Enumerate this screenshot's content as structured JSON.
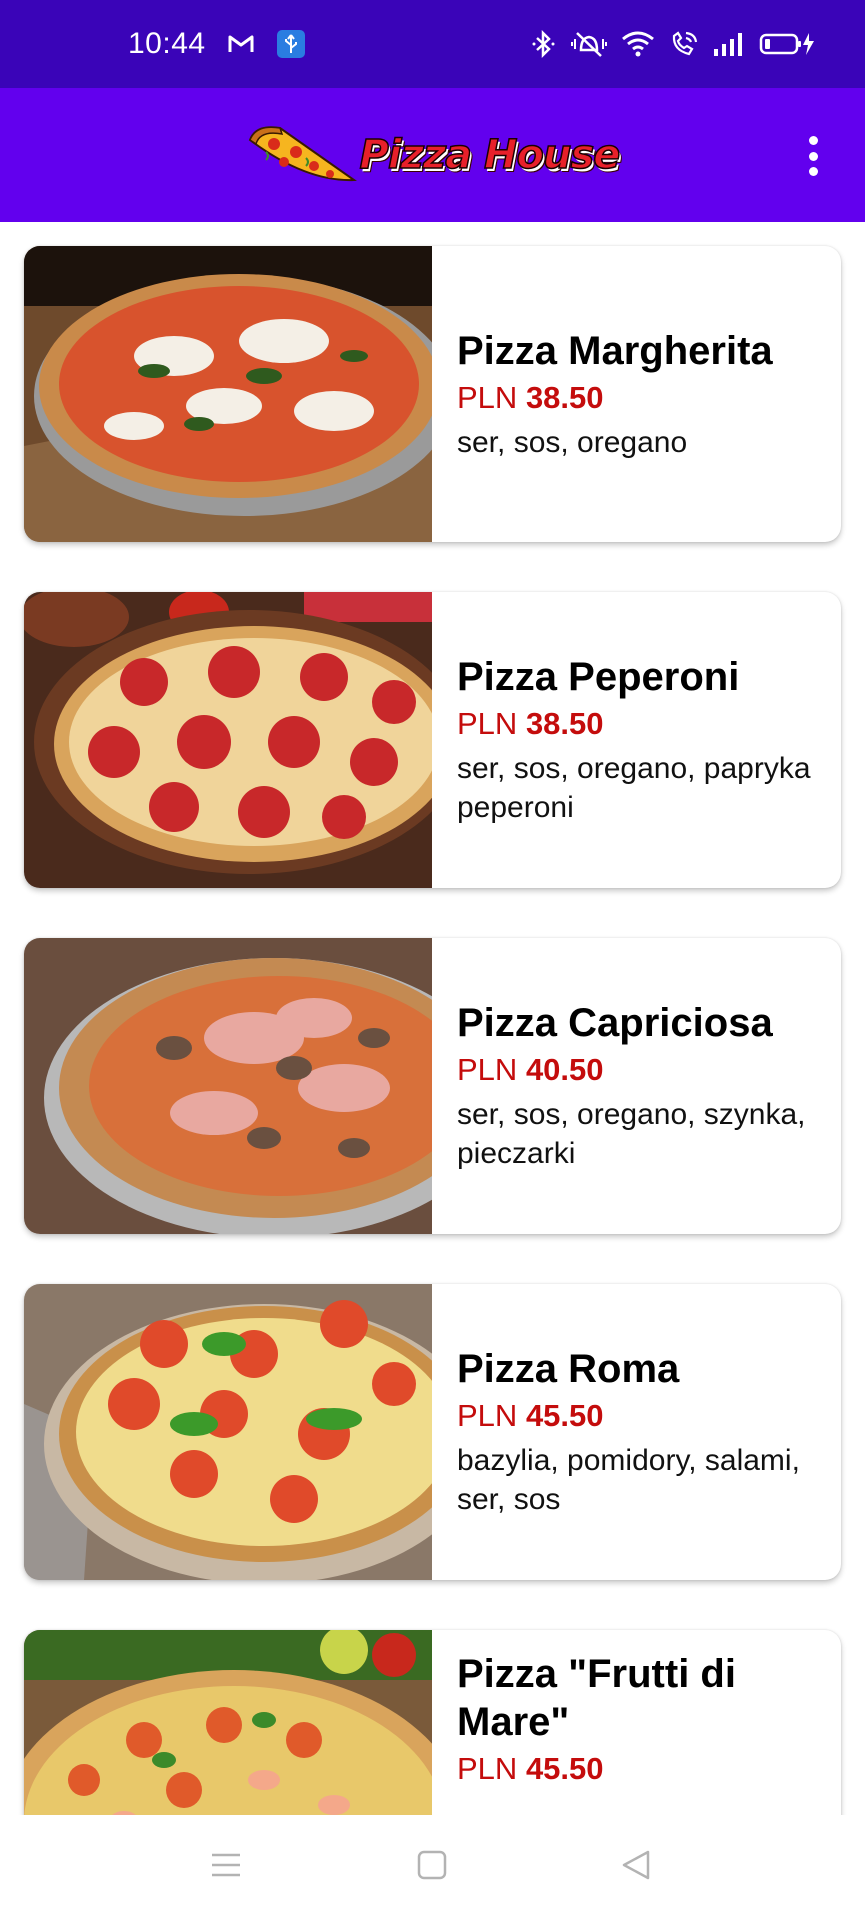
{
  "status_bar": {
    "time": "10:44",
    "notification_icons": [
      "gmail-icon",
      "usb-icon"
    ],
    "system_icons": [
      "bluetooth-icon",
      "vibrate-icon",
      "wifi-icon",
      "wifi-calling-icon",
      "signal-icon",
      "battery-charging-icon"
    ]
  },
  "app_bar": {
    "logo_text": "Pizza House",
    "menu_icon": "more-vertical-icon"
  },
  "colors": {
    "status_bar": "#3a04b8",
    "app_bar": "#6200ee",
    "price": "#c40c0c"
  },
  "pizzas": [
    {
      "name": "Pizza Margherita",
      "currency": "PLN",
      "price": "38.50",
      "ingredients": "ser, sos, oregano"
    },
    {
      "name": "Pizza Peperoni",
      "currency": "PLN",
      "price": "38.50",
      "ingredients": "ser, sos, oregano, papryka peperoni"
    },
    {
      "name": "Pizza Capriciosa",
      "currency": "PLN",
      "price": "40.50",
      "ingredients": "ser, sos, oregano, szynka, pieczarki"
    },
    {
      "name": "Pizza Roma",
      "currency": "PLN",
      "price": "45.50",
      "ingredients": "bazylia, pomidory, salami, ser, sos"
    },
    {
      "name": "Pizza \"Frutti di Mare\"",
      "currency": "PLN",
      "price": "45.50",
      "ingredients": ""
    }
  ],
  "nav_bar": {
    "buttons": [
      "menu-icon",
      "home-icon",
      "back-icon"
    ]
  }
}
